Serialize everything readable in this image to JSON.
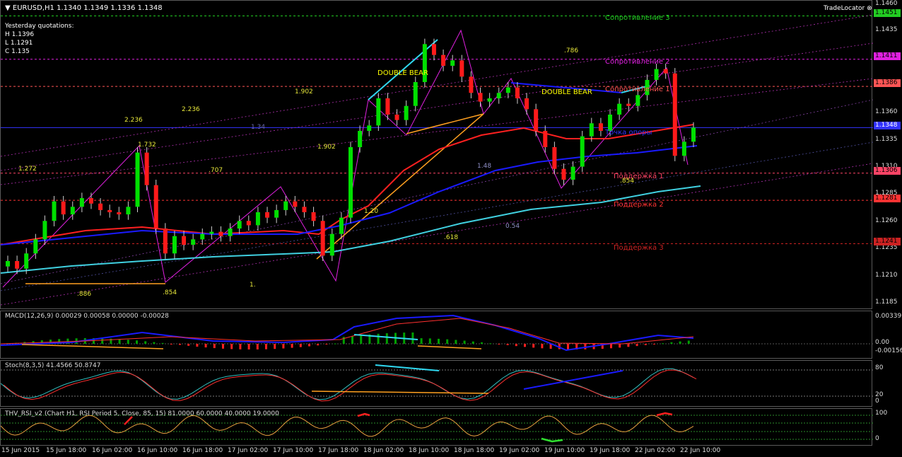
{
  "header": {
    "symbol_line": "EURUSD,H1  1.1340 1.1349 1.1336 1.1348",
    "yesterday_title": "Yesterday quotations:",
    "h": "H 1.1396",
    "l": "L 1.1291",
    "c": "C 1.135",
    "brand": "TradeLocator"
  },
  "price_axis": {
    "ticks": [
      "1.1460",
      "1.1435",
      "1.1360",
      "1.1335",
      "1.1310",
      "1.1285",
      "1.1260",
      "1.1235",
      "1.1210",
      "1.1185"
    ],
    "tags": {
      "r3": "1.1451",
      "r2": "1.1411",
      "r1": "1.1386",
      "pivot": "1.1348",
      "s1": "1.1306",
      "s2": "1.1281",
      "s3": "1.1241"
    }
  },
  "levels": {
    "r3": "Сопротивление 3",
    "r2": "Сопротивление 2",
    "r1": "Сопротивление 1",
    "pivot": "Точка опоры",
    "s1": "Поддержка 1",
    "s2": "Поддержка 2",
    "s3": "Поддержка 3"
  },
  "patterns": {
    "double_bear_1": "DOUBLE BEAR",
    "double_bear_2": "DOUBLE BEAR"
  },
  "fib_labels": {
    "f1": "1.272",
    "f2": "2.236",
    "f3": "1.732",
    "f4": "2.236",
    "f5": "1.902",
    "f6": "1.34",
    "f7": ".707",
    "f8": "1.902",
    "f9": ".786",
    "f10": "1.48",
    "f11": ".886",
    "f12": ".854",
    "f13": "1.",
    "f14": "1.20",
    "f15": ".618",
    "f16": "0.54",
    "f17": ".854"
  },
  "macd": {
    "title": "MACD(12,26,9) 0.00029 0.00058 0.00000 -0.00028",
    "ticks": [
      "0.00339",
      "0.00",
      "-0.00156"
    ]
  },
  "stoch": {
    "title": "Stoch(8,3,5) 41.4566 50.8747",
    "ticks": [
      "80",
      "20",
      "0"
    ]
  },
  "rsi": {
    "title": "THV_RSI_v2 (Chart H1, RSI Period 5, Close, 85, 15)  81.0000 60.0000 40.0000 19.0000",
    "ticks": [
      "100",
      "0"
    ]
  },
  "time_axis": [
    "15 Jun 2015",
    "15 Jun 18:00",
    "16 Jun 02:00",
    "16 Jun 10:00",
    "16 Jun 18:00",
    "17 Jun 02:00",
    "17 Jun 10:00",
    "17 Jun 18:00",
    "18 Jun 02:00",
    "18 Jun 10:00",
    "18 Jun 18:00",
    "19 Jun 02:00",
    "19 Jun 10:00",
    "19 Jun 18:00",
    "22 Jun 02:00",
    "22 Jun 10:00"
  ],
  "colors": {
    "bull": "#00e000",
    "bear": "#ff1a1a",
    "r3": "#22cc22",
    "r2": "#e020e0",
    "r1": "#ff5555",
    "pivot": "#3333ff",
    "s1": "#ff4466",
    "s2": "#ff3333",
    "s3": "#cc2222",
    "fib": "#e6e63a",
    "ma_red": "#ff2020",
    "ma_blue": "#1a1aff",
    "ma_cyan": "#40d0e0"
  },
  "chart_data": {
    "type": "candlestick",
    "symbol": "EURUSD",
    "timeframe": "H1",
    "ylim": [
      1.118,
      1.1465
    ],
    "closes": [
      1.1225,
      1.1218,
      1.1232,
      1.1245,
      1.1262,
      1.128,
      1.1268,
      1.1275,
      1.1283,
      1.1278,
      1.1272,
      1.127,
      1.1268,
      1.1275,
      1.1325,
      1.1295,
      1.1255,
      1.1232,
      1.1248,
      1.124,
      1.1245,
      1.125,
      1.1252,
      1.1248,
      1.1255,
      1.1262,
      1.1258,
      1.127,
      1.1265,
      1.1272,
      1.128,
      1.1275,
      1.127,
      1.1262,
      1.123,
      1.125,
      1.1265,
      1.133,
      1.1345,
      1.135,
      1.1375,
      1.136,
      1.1355,
      1.1368,
      1.139,
      1.1425,
      1.1415,
      1.1405,
      1.141,
      1.1395,
      1.138,
      1.1372,
      1.1375,
      1.138,
      1.1385,
      1.1375,
      1.1365,
      1.1345,
      1.133,
      1.131,
      1.13,
      1.1312,
      1.134,
      1.1352,
      1.1345,
      1.136,
      1.137,
      1.1368,
      1.1378,
      1.1392,
      1.1402,
      1.1398,
      1.1322,
      1.1335,
      1.1348
    ]
  }
}
